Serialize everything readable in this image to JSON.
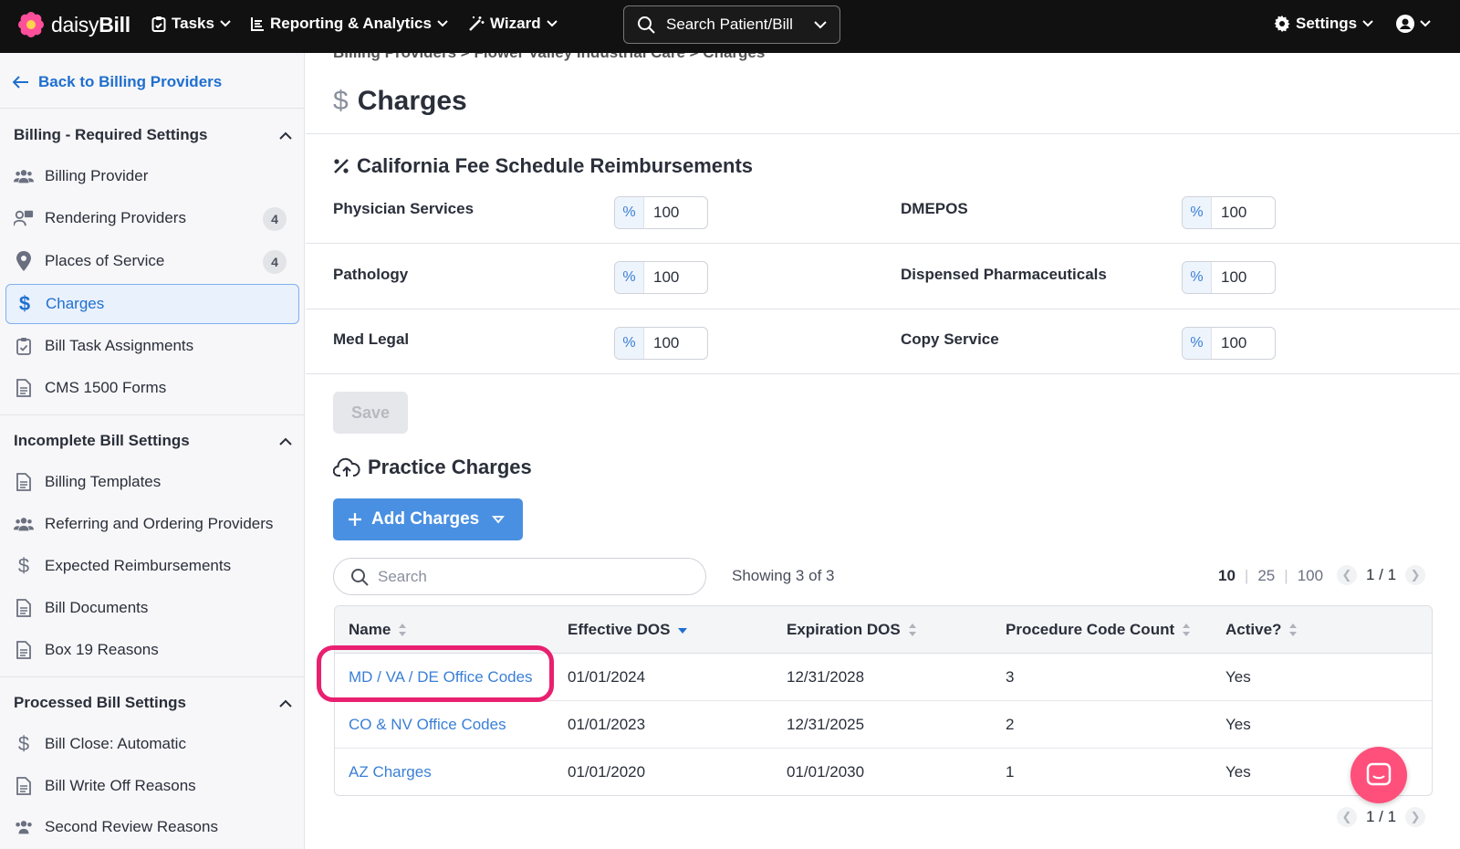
{
  "topbar": {
    "brand": "daisyBill",
    "brand_light": "daisy",
    "brand_bold": "Bill",
    "nav": [
      {
        "label": "Tasks",
        "icon": "clipboard-icon"
      },
      {
        "label": "Reporting & Analytics",
        "icon": "report-icon"
      },
      {
        "label": "Wizard",
        "icon": "wand-icon"
      }
    ],
    "search_label": "Search Patient/Bill",
    "settings_label": "Settings"
  },
  "sidebar": {
    "back_label": "Back to Billing Providers",
    "groups": [
      {
        "title": "Billing - Required Settings",
        "items": [
          {
            "label": "Billing Provider",
            "icon": "users-icon"
          },
          {
            "label": "Rendering Providers",
            "icon": "user-board-icon",
            "badge": "4"
          },
          {
            "label": "Places of Service",
            "icon": "map-pin-icon",
            "badge": "4"
          },
          {
            "label": "Charges",
            "icon": "dollar-icon",
            "active": true
          },
          {
            "label": "Bill Task Assignments",
            "icon": "clipboard-check-icon"
          },
          {
            "label": "CMS 1500 Forms",
            "icon": "document-icon"
          }
        ]
      },
      {
        "title": "Incomplete Bill Settings",
        "items": [
          {
            "label": "Billing Templates",
            "icon": "document-icon"
          },
          {
            "label": "Referring and Ordering Providers",
            "icon": "users-icon"
          },
          {
            "label": "Expected Reimbursements",
            "icon": "dollar-icon"
          },
          {
            "label": "Bill Documents",
            "icon": "document-icon"
          },
          {
            "label": "Box 19 Reasons",
            "icon": "document-icon"
          }
        ]
      },
      {
        "title": "Processed Bill Settings",
        "items": [
          {
            "label": "Bill Close: Automatic",
            "icon": "dollar-icon"
          },
          {
            "label": "Bill Write Off Reasons",
            "icon": "document-icon"
          },
          {
            "label": "Second Review Reasons",
            "icon": "users-icon"
          }
        ]
      }
    ]
  },
  "main": {
    "breadcrumb": "Billing Providers  >  Flower Valley Industrial Care  >  Charges",
    "title": "Charges",
    "fee_schedule": {
      "title": "California Fee Schedule Reimbursements",
      "prefix": "%",
      "rows": [
        {
          "left_label": "Physician Services",
          "left_value": "100",
          "right_label": "DMEPOS",
          "right_value": "100"
        },
        {
          "left_label": "Pathology",
          "left_value": "100",
          "right_label": "Dispensed Pharmaceuticals",
          "right_value": "100"
        },
        {
          "left_label": "Med Legal",
          "left_value": "100",
          "right_label": "Copy Service",
          "right_value": "100"
        }
      ],
      "save_label": "Save"
    },
    "practice": {
      "title": "Practice Charges",
      "add_label": "Add Charges",
      "search_placeholder": "Search",
      "showing": "Showing 3 of 3",
      "page_sizes": [
        "10",
        "25",
        "100"
      ],
      "page_size_selected": "10",
      "pager": "1 / 1",
      "columns": [
        "Name",
        "Effective DOS",
        "Expiration DOS",
        "Procedure Code Count",
        "Active?"
      ],
      "rows": [
        {
          "name": "MD / VA / DE Office Codes",
          "effective": "01/01/2024",
          "expiration": "12/31/2028",
          "count": "3",
          "active": "Yes"
        },
        {
          "name": "CO & NV Office Codes",
          "effective": "01/01/2023",
          "expiration": "12/31/2025",
          "count": "2",
          "active": "Yes"
        },
        {
          "name": "AZ Charges",
          "effective": "01/01/2020",
          "expiration": "01/01/2030",
          "count": "1",
          "active": "Yes"
        }
      ]
    }
  },
  "colors": {
    "accent": "#4a90e2",
    "link": "#3a7fd6",
    "highlight": "#e8206f",
    "topbar": "#111111"
  }
}
